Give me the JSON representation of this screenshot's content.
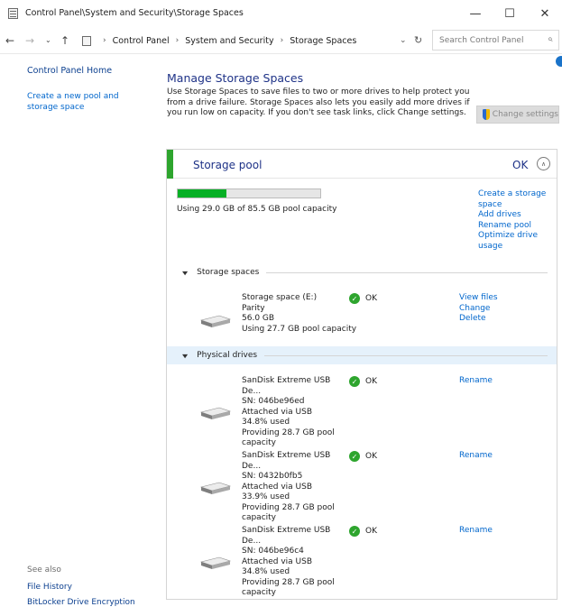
{
  "window": {
    "title": "Control Panel\\System and Security\\Storage Spaces",
    "minimize_glyph": "—",
    "maximize_glyph": "☐",
    "close_glyph": "✕"
  },
  "address": {
    "crumbs": [
      "Control Panel",
      "System and Security",
      "Storage Spaces"
    ],
    "search_placeholder": "Search Control Panel"
  },
  "left_pane": {
    "home": "Control Panel Home",
    "create_pool": "Create a new pool and storage space",
    "see_also": "See also",
    "links": [
      "File History",
      "BitLocker Drive Encryption"
    ]
  },
  "main": {
    "heading": "Manage Storage Spaces",
    "intro": "Use Storage Spaces to save files to two or more drives to help protect you from a drive failure. Storage Spaces also lets you easily add more drives if you run low on capacity. If you don't see task links, click Change settings.",
    "change_settings": "Change settings"
  },
  "pool": {
    "title": "Storage pool",
    "status": "OK",
    "used_fraction": 0.339,
    "capacity_text": "Using 29.0 GB of 85.5 GB pool capacity",
    "tasks": [
      "Create a storage space",
      "Add drives",
      "Rename pool",
      "Optimize drive usage"
    ],
    "accent_color": "#2ea52e"
  },
  "storage_spaces": {
    "section_title": "Storage spaces",
    "items": [
      {
        "lines": [
          "Storage space (E:)",
          "Parity",
          "56.0 GB",
          "Using 27.7 GB pool capacity"
        ],
        "status": "OK",
        "actions": [
          "View files",
          "Change",
          "Delete"
        ]
      }
    ]
  },
  "physical_drives": {
    "section_title": "Physical drives",
    "items": [
      {
        "lines": [
          "SanDisk Extreme USB De...",
          "SN: 046be96ed",
          "Attached via USB",
          "34.8% used",
          "Providing 28.7 GB pool capacity"
        ],
        "status": "OK",
        "action": "Rename"
      },
      {
        "lines": [
          "SanDisk Extreme USB De...",
          "SN: 0432b0fb5",
          "Attached via USB",
          "33.9% used",
          "Providing 28.7 GB pool capacity"
        ],
        "status": "OK",
        "action": "Rename"
      },
      {
        "lines": [
          "SanDisk Extreme USB De...",
          "SN: 046be96c4",
          "Attached via USB",
          "34.8% used",
          "Providing 28.7 GB pool capacity"
        ],
        "status": "OK",
        "action": "Rename"
      }
    ]
  }
}
